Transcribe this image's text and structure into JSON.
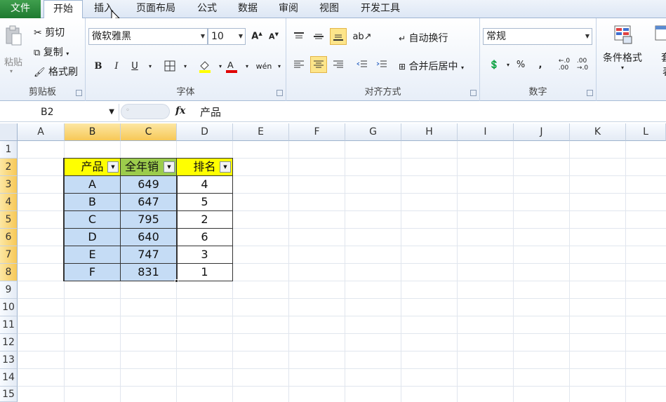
{
  "tabs": [
    "文件",
    "开始",
    "插入",
    "页面布局",
    "公式",
    "数据",
    "审阅",
    "视图",
    "开发工具"
  ],
  "clipboard": {
    "paste": "粘贴",
    "cut": "剪切",
    "copy": "复制",
    "painter": "格式刷",
    "label": "剪贴板"
  },
  "font": {
    "name": "微软雅黑",
    "size": "10",
    "label": "字体"
  },
  "alignment": {
    "wrap": "自动换行",
    "merge": "合并后居中",
    "label": "对齐方式"
  },
  "number": {
    "format": "常规",
    "label": "数字"
  },
  "styles": {
    "cond": "条件格式",
    "table": "套",
    "table2": "表格"
  },
  "formula_bar": {
    "name_box": "B2",
    "fx": "fx",
    "content": "产品"
  },
  "columns": [
    "A",
    "B",
    "C",
    "D",
    "E",
    "F",
    "G",
    "H",
    "I",
    "J",
    "K",
    "L"
  ],
  "rows": [
    "1",
    "2",
    "3",
    "4",
    "5",
    "6",
    "7",
    "8",
    "9",
    "10",
    "11",
    "12",
    "13",
    "14",
    "15"
  ],
  "table": {
    "headers": [
      "产品",
      "全年销",
      "排名"
    ],
    "rows": [
      [
        "A",
        "649",
        "4"
      ],
      [
        "B",
        "647",
        "5"
      ],
      [
        "C",
        "795",
        "2"
      ],
      [
        "D",
        "640",
        "6"
      ],
      [
        "E",
        "747",
        "3"
      ],
      [
        "F",
        "831",
        "1"
      ]
    ]
  }
}
